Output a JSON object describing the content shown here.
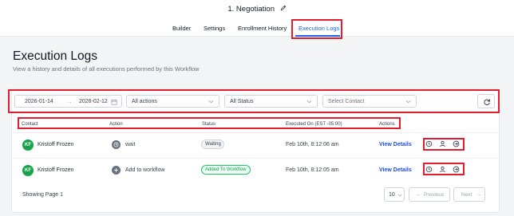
{
  "header": {
    "workflow_title": "1. Negotiation",
    "tabs": [
      {
        "label": "Builder"
      },
      {
        "label": "Settings"
      },
      {
        "label": "Enrollment History"
      },
      {
        "label": "Execution Logs"
      }
    ],
    "active_tab": "Execution Logs"
  },
  "page": {
    "title": "Execution Logs",
    "subtitle": "View a history and details of all executions performed by this Workflow"
  },
  "filters": {
    "date_from": "2026-01-14",
    "date_to": "2026-02-12",
    "date_separator": "→",
    "action_select": "All actions",
    "status_select": "All Status",
    "contact_placeholder": "Select Contact"
  },
  "table": {
    "columns": [
      "Contact",
      "Action",
      "Status",
      "Executed On (EST -05:00)",
      "Actions"
    ],
    "rows": [
      {
        "avatar_initials": "KF",
        "contact": "Kristoff Frozen",
        "action_icon": "clock-icon",
        "action": "wait",
        "status": "Waiting",
        "executed_on": "Feb 10th, 8:12:06 am",
        "link": "View Details"
      },
      {
        "avatar_initials": "KF",
        "contact": "Kristoff Frozen",
        "action_icon": "plus-icon",
        "action": "Add to workflow",
        "status": "Added To Workflow",
        "executed_on": "Feb 10th, 8:12:05 am",
        "link": "View Details"
      }
    ]
  },
  "footer": {
    "page_info": "Showing Page 1",
    "page_size": "10",
    "prev_label": "Previous",
    "next_label": "Next"
  },
  "colors": {
    "accent": "#2563eb",
    "highlight_box": "#e11d2e",
    "avatar": "#16a34a",
    "added_status": "#16a34a"
  }
}
